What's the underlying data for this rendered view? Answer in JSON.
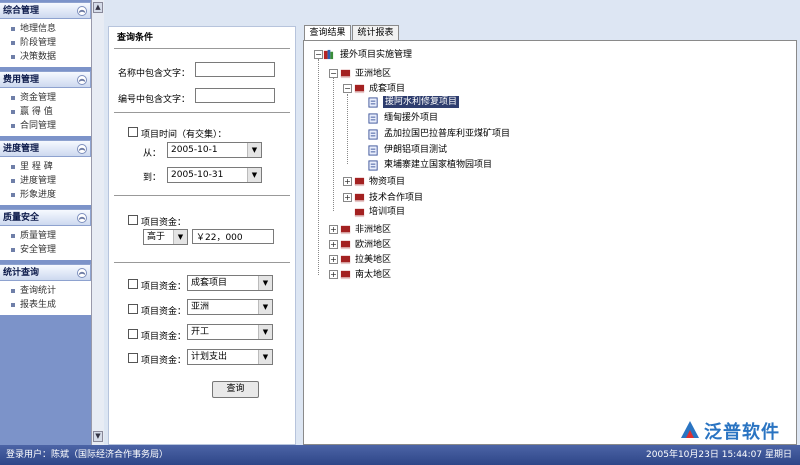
{
  "sidebar": {
    "sections": [
      {
        "title": "综合管理",
        "items": [
          "地理信息",
          "阶段管理",
          "决策数据"
        ]
      },
      {
        "title": "费用管理",
        "items": [
          "资金管理",
          "赢 得 值",
          "合同管理"
        ]
      },
      {
        "title": "进度管理",
        "items": [
          "里 程 碑",
          "进度管理",
          "形象进度"
        ]
      },
      {
        "title": "质量安全",
        "items": [
          "质量管理",
          "安全管理"
        ]
      },
      {
        "title": "统计查询",
        "items": [
          "查询统计",
          "报表生成"
        ]
      }
    ]
  },
  "query": {
    "title": "查询条件",
    "name_label": "名称中包含文字：",
    "name_value": "",
    "code_label": "编号中包含文字：",
    "code_value": "",
    "time_label": "项目时间（有交集）：",
    "from_label": "从：",
    "from_value": "2005-10-1",
    "to_label": "到：",
    "to_value": "2005-10-31",
    "fund_label": "项目资金：",
    "fund_op": "高于",
    "fund_value": "￥22，000",
    "filters": [
      {
        "label": "项目资金：",
        "value": "成套项目"
      },
      {
        "label": "项目资金：",
        "value": "亚洲"
      },
      {
        "label": "项目资金：",
        "value": "开工"
      },
      {
        "label": "项目资金：",
        "value": "计划支出"
      }
    ],
    "button": "查询"
  },
  "tabs": [
    "查询结果",
    "统计报表"
  ],
  "tree": {
    "root": "援外项目实施管理",
    "asia": "亚洲地区",
    "complete": "成套项目",
    "projects": [
      "援阿水利修复项目",
      "缅甸援外项目",
      "孟加拉国巴拉普库利亚煤矿项目",
      "伊朗铝项目测试",
      "柬埔寨建立国家植物园项目"
    ],
    "asia_others": [
      "物资项目",
      "技术合作项目",
      "培训项目"
    ],
    "regions": [
      "非洲地区",
      "欧洲地区",
      "拉美地区",
      "南太地区"
    ]
  },
  "status": {
    "user": "登录用户：陈斌（国际经济合作事务局）",
    "clock": "2005年10月23日  15:44:07  星期日"
  },
  "logo": {
    "text": "泛普软件"
  },
  "colors": {
    "sidebar": "#7c93c9",
    "status": "#3a5298",
    "highlight": "#2e3d6e",
    "logo": "#2a74c2"
  }
}
